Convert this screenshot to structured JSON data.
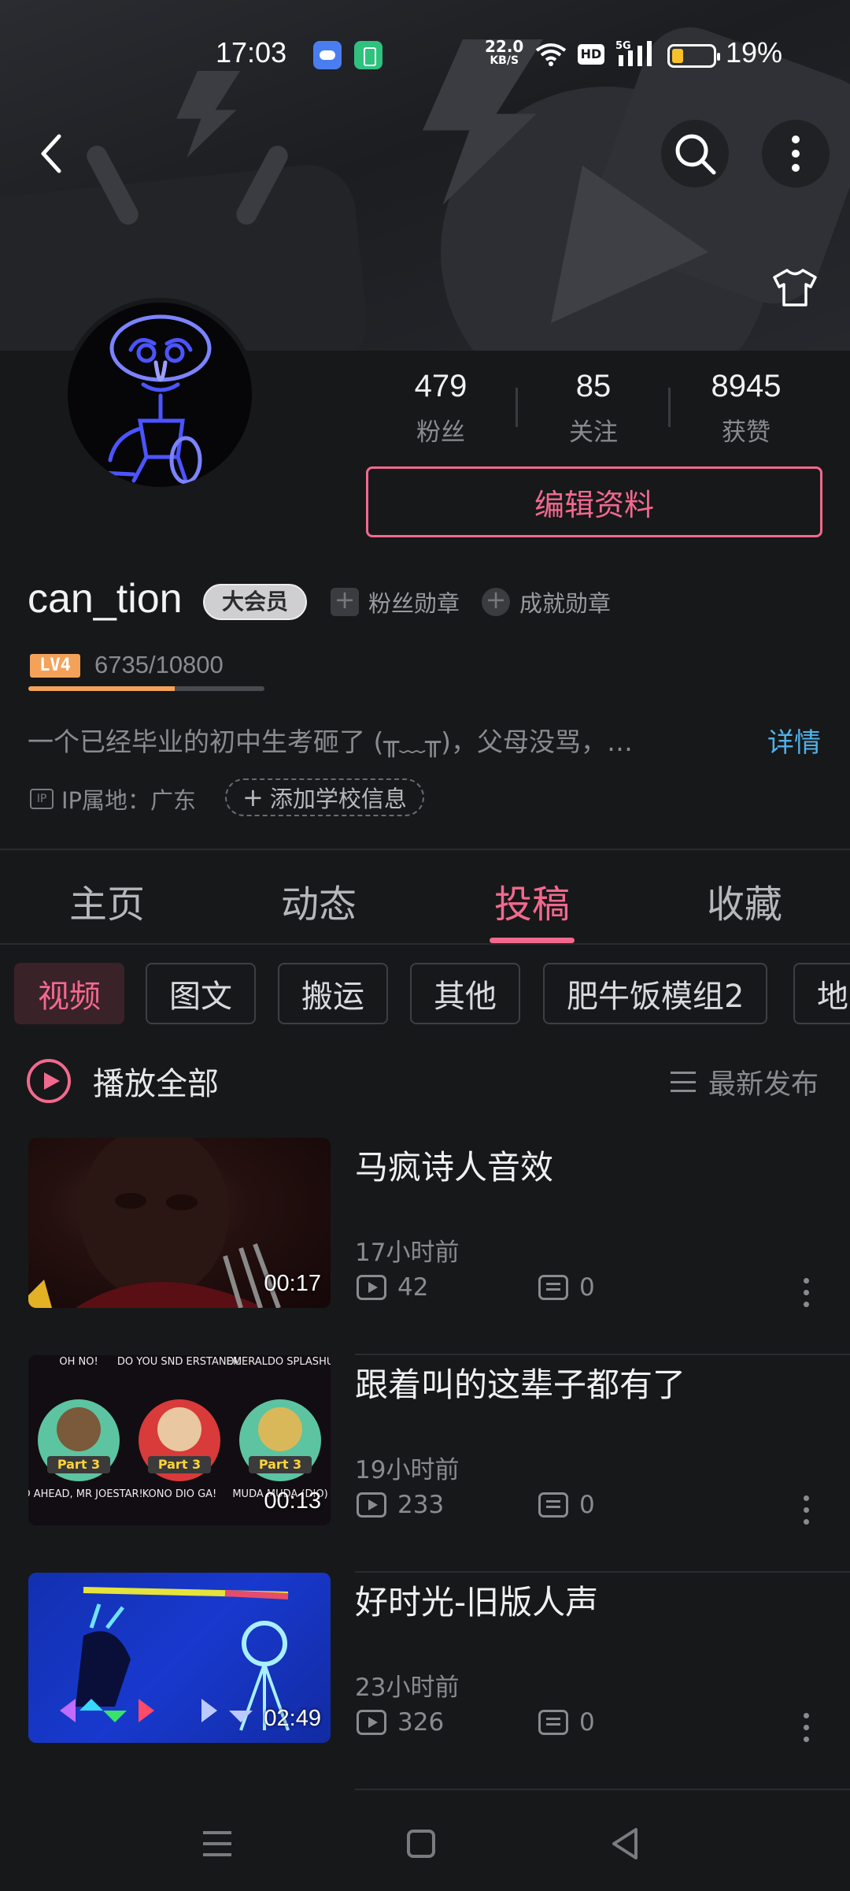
{
  "status_bar": {
    "time": "17:03",
    "net_speed": "22.0",
    "net_unit": "KB/S",
    "hd": "HD",
    "network": "5G",
    "battery_percent": "19%",
    "battery_level": 0.19
  },
  "profile": {
    "username": "can_tion",
    "vip_badge": "大会员",
    "fan_medal": "粉丝勋章",
    "achievement_medal": "成就勋章",
    "level_label": "LV4",
    "level_progress": "6735/10800",
    "level_fraction": 0.62,
    "bio": "一个已经毕业的初中生考砸了 (╥﹏╥)，父母没骂，…",
    "bio_more": "详情",
    "ip_icon": "IP",
    "ip_location": "IP属地：广东",
    "add_school": "添加学校信息",
    "edit_button": "编辑资料"
  },
  "stats": [
    {
      "value": "479",
      "label": "粉丝"
    },
    {
      "value": "85",
      "label": "关注"
    },
    {
      "value": "8945",
      "label": "获赞"
    }
  ],
  "tabs": [
    "主页",
    "动态",
    "投稿",
    "收藏"
  ],
  "active_tab": "投稿",
  "chips": [
    "视频",
    "图文",
    "搬运",
    "其他",
    "肥牛饭模组2",
    "地"
  ],
  "play_all": "播放全部",
  "sort_label": "最新发布",
  "videos": [
    {
      "title": "马疯诗人音效",
      "time_ago": "17小时前",
      "plays": "42",
      "comments": "0",
      "duration": "00:17"
    },
    {
      "title": "跟着叫的这辈子都有了",
      "time_ago": "19小时前",
      "plays": "233",
      "comments": "0",
      "duration": "00:13"
    },
    {
      "title": "好时光-旧版人声",
      "time_ago": "23小时前",
      "plays": "326",
      "comments": "0",
      "duration": "02:49"
    }
  ],
  "thumb2_text": {
    "top": [
      "OH NO!",
      "DO YOU SND ERSTANDU",
      "EMERALDO SPLASHU"
    ],
    "parts": [
      "Part 3",
      "Part 3",
      "Part 3"
    ],
    "bottom": [
      "GO AHEAD, MR JOESTAR!",
      "KONO DIO GA!",
      "MUDA MUDA (DIO)"
    ]
  },
  "colors": {
    "accent": "#f2698e",
    "link": "#4fb0e8",
    "level": "#f4a25a",
    "background": "#17181a"
  },
  "icons": [
    "back-icon",
    "search-icon",
    "more-icon",
    "shirt-icon",
    "play-circle-icon",
    "list-icon",
    "play-count-icon",
    "comment-icon",
    "kebab-icon",
    "menu-icon",
    "home-icon",
    "back-triangle-icon"
  ]
}
